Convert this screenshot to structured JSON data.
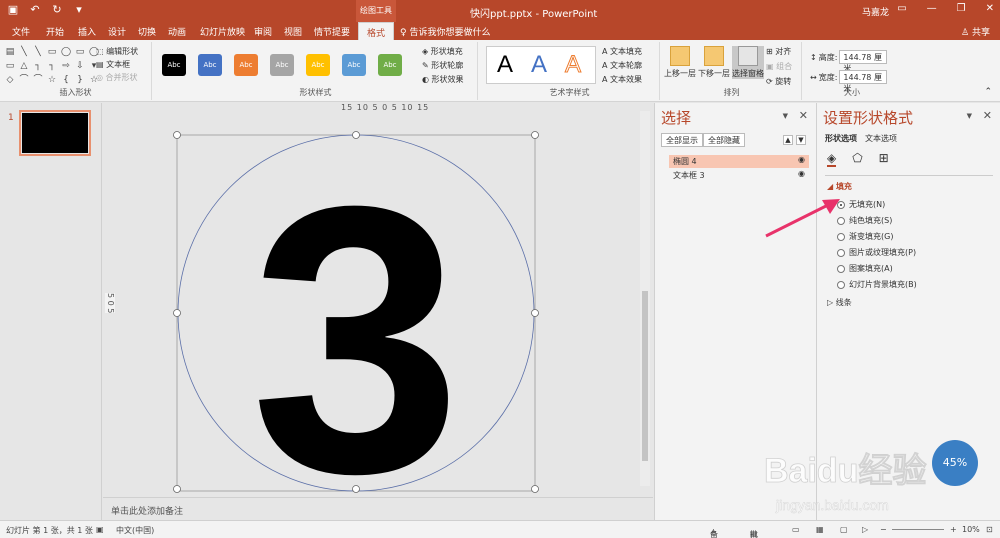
{
  "titlebar": {
    "doc_title": "快闪ppt.pptx - PowerPoint",
    "tool_context": "绘图工具",
    "user": "马嘉龙",
    "quick_access": [
      "save-icon",
      "undo-icon",
      "redo-icon",
      "customize-icon"
    ]
  },
  "tabs": [
    "文件",
    "开始",
    "插入",
    "设计",
    "切换",
    "动画",
    "幻灯片放映",
    "审阅",
    "视图",
    "情节提要",
    "格式"
  ],
  "active_tab": "格式",
  "tellme": "告诉我你想要做什么",
  "share": "共享",
  "ribbon": {
    "insert_shapes": {
      "label": "插入形状",
      "edit_shape": "编辑形状",
      "textbox": "文本框",
      "merge_shapes": "合并形状"
    },
    "shape_styles": {
      "label": "形状样式",
      "swatch_text": "Abc",
      "swatch_colors": [
        "#000000",
        "#4472c4",
        "#ed7d31",
        "#a5a5a5",
        "#ffc000",
        "#5b9bd5",
        "#70ad47"
      ],
      "fill": "形状填充",
      "outline": "形状轮廓",
      "effects": "形状效果"
    },
    "wordart": {
      "label": "艺术字样式",
      "letter": "A",
      "text_fill": "文本填充",
      "text_outline": "文本轮廓",
      "text_effects": "文本效果"
    },
    "arrange": {
      "label": "排列",
      "bring_forward": "上移一层",
      "send_backward": "下移一层",
      "selection_pane": "选择窗格",
      "align": "对齐",
      "group": "组合",
      "rotate": "旋转"
    },
    "size": {
      "label": "大小",
      "height_label": "高度:",
      "height_value": "144.78 厘米",
      "width_label": "宽度:",
      "width_value": "144.78 厘米"
    }
  },
  "thumbs": {
    "slide_number": "1"
  },
  "canvas": {
    "ruler_h": "15 10 5 0 5 10 15",
    "ruler_v": "5 0 5",
    "numeral": "3",
    "notes_placeholder": "单击此处添加备注"
  },
  "selection_pane": {
    "title": "选择",
    "show_all": "全部显示",
    "hide_all": "全部隐藏",
    "items": [
      {
        "name": "椭圆 4"
      },
      {
        "name": "文本框 3"
      }
    ]
  },
  "format_pane": {
    "title": "设置形状格式",
    "tab_shape": "形状选项",
    "tab_text": "文本选项",
    "fill_section": "填充",
    "line_section": "线条",
    "fill_options": [
      "无填充(N)",
      "纯色填充(S)",
      "渐变填充(G)",
      "图片或纹理填充(P)",
      "图案填充(A)",
      "幻灯片背景填充(B)"
    ],
    "selected_fill": "无填充(N)"
  },
  "watermark": {
    "brand": "Baidu经验",
    "url": "jingyan.baidu.com",
    "progress": "45%"
  },
  "statusbar": {
    "slide_info": "幻灯片 第 1 张，共 1 张",
    "language": "中文(中国)",
    "notes": "备注",
    "comments": "批注",
    "zoom": "10%"
  },
  "colors": {
    "accent": "#b7472a",
    "selected_item": "#f8c6b2",
    "arrow": "#e8326a"
  }
}
